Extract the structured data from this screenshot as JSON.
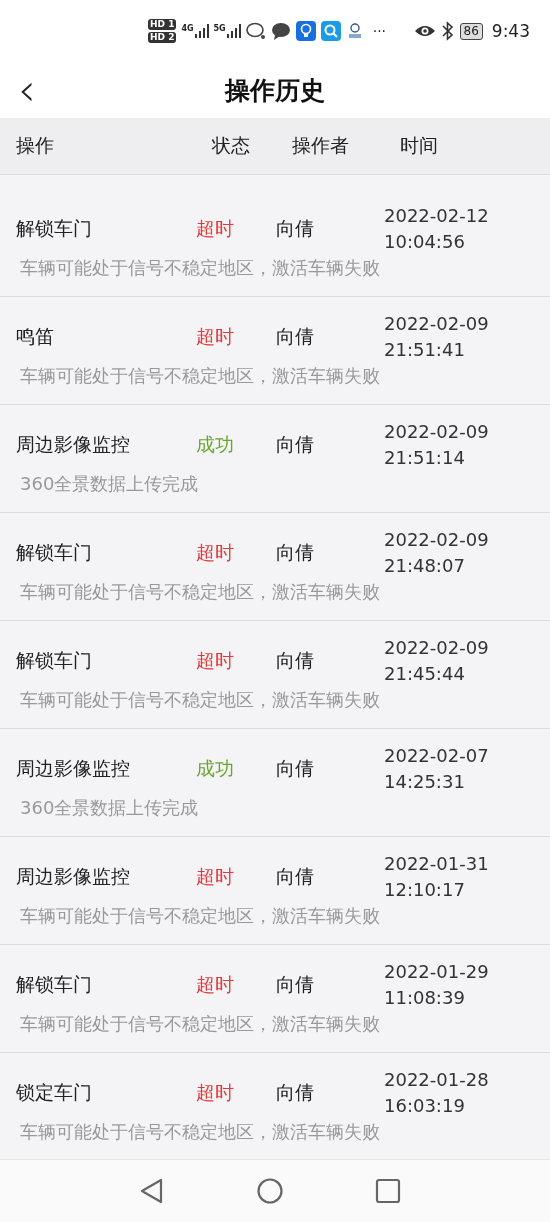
{
  "status_bar": {
    "sims": [
      "HD 1",
      "HD 2"
    ],
    "networks": [
      "4G",
      "5G"
    ],
    "more": "···",
    "battery": "86",
    "time": "9:43"
  },
  "header": {
    "back": "‹",
    "title": "操作历史"
  },
  "table": {
    "columns": [
      "操作",
      "状态",
      "操作者",
      "时间"
    ],
    "rows": [
      {
        "action": "解锁车门",
        "status": "超时",
        "color": "#e03a3a",
        "operator": "向倩",
        "date": "2022-02-12",
        "time": "10:04:56",
        "detail": "车辆可能处于信号不稳定地区，激活车辆失败"
      },
      {
        "action": "鸣笛",
        "status": "超时",
        "color": "#e03a3a",
        "operator": "向倩",
        "date": "2022-02-09",
        "time": "21:51:41",
        "detail": "车辆可能处于信号不稳定地区，激活车辆失败"
      },
      {
        "action": "周边影像监控",
        "status": "成功",
        "color": "#6aa62c",
        "operator": "向倩",
        "date": "2022-02-09",
        "time": "21:51:14",
        "detail": "360全景数据上传完成"
      },
      {
        "action": "解锁车门",
        "status": "超时",
        "color": "#e03a3a",
        "operator": "向倩",
        "date": "2022-02-09",
        "time": "21:48:07",
        "detail": "车辆可能处于信号不稳定地区，激活车辆失败"
      },
      {
        "action": "解锁车门",
        "status": "超时",
        "color": "#e03a3a",
        "operator": "向倩",
        "date": "2022-02-09",
        "time": "21:45:44",
        "detail": "车辆可能处于信号不稳定地区，激活车辆失败"
      },
      {
        "action": "周边影像监控",
        "status": "成功",
        "color": "#6aa62c",
        "operator": "向倩",
        "date": "2022-02-07",
        "time": "14:25:31",
        "detail": "360全景数据上传完成"
      },
      {
        "action": "周边影像监控",
        "status": "超时",
        "color": "#e03a3a",
        "operator": "向倩",
        "date": "2022-01-31",
        "time": "12:10:17",
        "detail": "车辆可能处于信号不稳定地区，激活车辆失败"
      },
      {
        "action": "解锁车门",
        "status": "超时",
        "color": "#e03a3a",
        "operator": "向倩",
        "date": "2022-01-29",
        "time": "11:08:39",
        "detail": "车辆可能处于信号不稳定地区，激活车辆失败"
      },
      {
        "action": "锁定车门",
        "status": "超时",
        "color": "#e03a3a",
        "operator": "向倩",
        "date": "2022-01-28",
        "time": "16:03:19",
        "detail": "车辆可能处于信号不稳定地区，激活车辆失败"
      }
    ]
  }
}
